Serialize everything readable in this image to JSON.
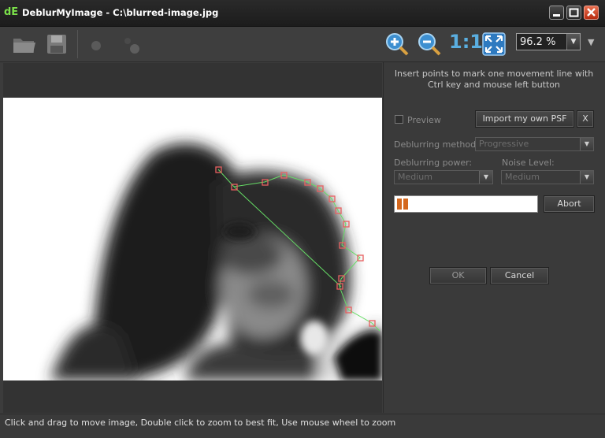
{
  "window": {
    "title": "DeblurMyImage - C:\\blurred-image.jpg",
    "app_icon": "dE"
  },
  "toolbar": {
    "zoom_one_to_one": "1:1",
    "zoom_value": "96.2 %",
    "dropdown_arrow": "▼"
  },
  "panel": {
    "hint": "Insert points to mark one movement line with Ctrl key and mouse left button",
    "preview_label": "Preview",
    "import_psf_label": "Import my own PSF",
    "clear_psf_label": "X",
    "method_label": "Deblurring method:",
    "method_value": "Progressive",
    "power_label": "Deblurring power:",
    "power_value": "Medium",
    "noise_label": "Noise Level:",
    "noise_value": "Medium",
    "progress": 0.08,
    "abort_label": "Abort",
    "ok_label": "OK",
    "cancel_label": "Cancel"
  },
  "status": {
    "text": "Click and drag to move image, Double click to zoom to best fit, Use mouse wheel to zoom"
  },
  "colors": {
    "accent": "#5aaee0",
    "marker": "#e86060",
    "path_line": "#66dd66",
    "progress": "#d4681e"
  },
  "icons": [
    "open-folder-icon",
    "save-icon",
    "record-icon",
    "steps-icon",
    "zoom-in-icon",
    "zoom-out-icon",
    "fit-window-icon",
    "minimize-icon",
    "maximize-icon",
    "close-icon"
  ]
}
